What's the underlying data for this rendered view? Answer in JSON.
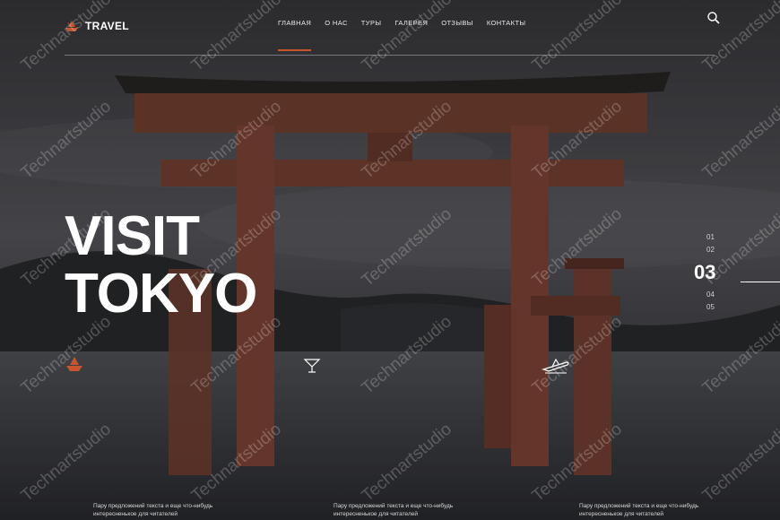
{
  "header": {
    "logo_text": "TRAVEL",
    "nav": [
      {
        "label": "ГЛАВНАЯ",
        "active": true
      },
      {
        "label": "О НАС"
      },
      {
        "label": "ТУРЫ"
      },
      {
        "label": "ГАЛЕРЕЯ"
      },
      {
        "label": "ОТЗЫВЫ"
      },
      {
        "label": "КОНТАКТЫ"
      }
    ],
    "search_icon": "search-icon"
  },
  "hero": {
    "line1": "VISIT",
    "line2": "TOKYO"
  },
  "slider": {
    "items": [
      "01",
      "02",
      "03",
      "04",
      "05"
    ],
    "current": "03"
  },
  "features": [
    {
      "icon": "boat-icon",
      "text": "Пару предложений текста и еще что-нибудь интересненькое для читателей"
    },
    {
      "icon": "cocktail-icon",
      "text": "Пару предложений текста и еще что-нибудь интересненькое для читателей"
    },
    {
      "icon": "plane-icon",
      "text": "Пару предложений текста и еще что-нибудь интересненькое для читателей"
    }
  ],
  "watermark": "Technartstudio",
  "colors": {
    "accent": "#c9552e",
    "gate": "#8a4a38",
    "sky": "#4a4a4f"
  }
}
